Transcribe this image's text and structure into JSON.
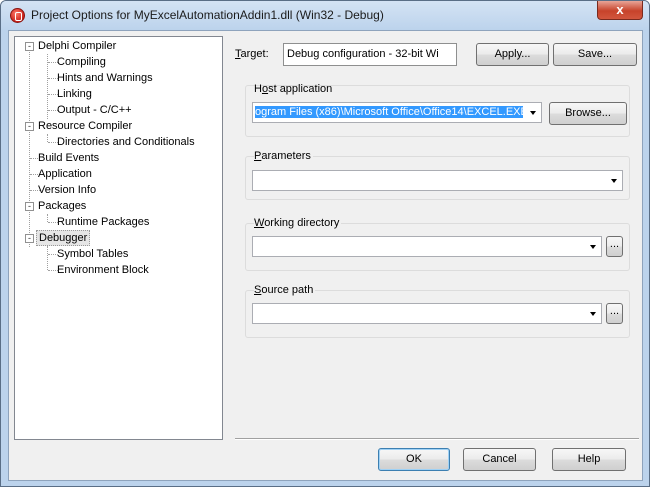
{
  "window": {
    "title": "Project Options for MyExcelAutomationAddin1.dll  (Win32 - Debug)",
    "close_glyph": "x"
  },
  "tree": {
    "items": [
      {
        "label": "Delphi Compiler",
        "level": 0,
        "expander": "-"
      },
      {
        "label": "Compiling",
        "level": 1
      },
      {
        "label": "Hints and Warnings",
        "level": 1
      },
      {
        "label": "Linking",
        "level": 1
      },
      {
        "label": "Output - C/C++",
        "level": 1
      },
      {
        "label": "Resource Compiler",
        "level": 0,
        "expander": "-"
      },
      {
        "label": "Directories and Conditionals",
        "level": 1
      },
      {
        "label": "Build Events",
        "level": 0
      },
      {
        "label": "Application",
        "level": 0
      },
      {
        "label": "Version Info",
        "level": 0
      },
      {
        "label": "Packages",
        "level": 0,
        "expander": "-"
      },
      {
        "label": "Runtime Packages",
        "level": 1
      },
      {
        "label": "Debugger",
        "level": 0,
        "expander": "-",
        "selected": true
      },
      {
        "label": "Symbol Tables",
        "level": 1
      },
      {
        "label": "Environment Block",
        "level": 1
      }
    ]
  },
  "target": {
    "label_underlined": "T",
    "label_rest": "arget:",
    "value": "Debug configuration - 32-bit Wi",
    "apply_label": "Apply...",
    "save_label": "Save..."
  },
  "host_application": {
    "label_pre": "H",
    "label_underlined": "o",
    "label_rest": "st application",
    "value": "ogram Files (x86)\\Microsoft Office\\Office14\\EXCEL.EXE",
    "browse_label": "Browse..."
  },
  "parameters": {
    "label_underlined": "P",
    "label_rest": "arameters",
    "value": ""
  },
  "working_directory": {
    "label_underlined": "W",
    "label_rest": "orking directory",
    "value": "",
    "ellipsis_label": "..."
  },
  "source_path": {
    "label_underlined": "S",
    "label_rest": "ource path",
    "value": "",
    "ellipsis_label": "..."
  },
  "footer": {
    "ok_label": "OK",
    "cancel_label": "Cancel",
    "help_label": "Help"
  }
}
